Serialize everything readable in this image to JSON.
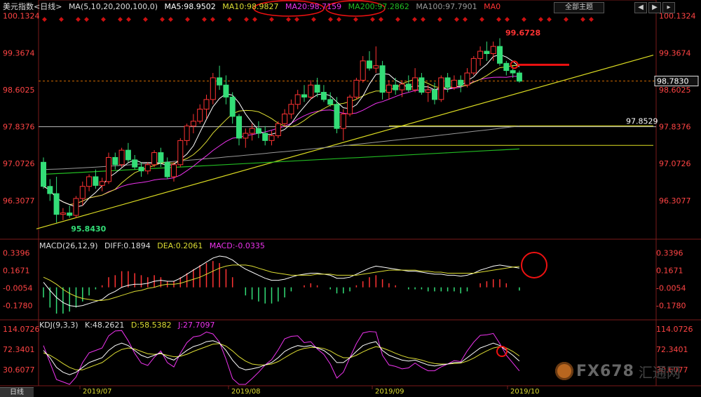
{
  "header": {
    "title": "美元指数<日线>",
    "ma_params": "MA(5,10,20,200,100,0)",
    "ma5": "MA5:98.9502",
    "ma10": "MA10:98.9827",
    "ma20": "MA20:98.7159",
    "ma200": "MA200:97.2862",
    "ma100": "MA100:97.7901",
    "ma0": "MA0"
  },
  "toolbar": {
    "dropdown_label": "全部主题",
    "nav": [
      "◀",
      "▶",
      "▸"
    ]
  },
  "macd_header": {
    "params": "MACD(26,12,9)",
    "diff": "DIFF:0.1894",
    "dea": "DEA:0.2061",
    "macd": "MACD:-0.0335"
  },
  "kdj_header": {
    "params": "KDJ(9,3,3)",
    "k": "K:48.2621",
    "d": "D:58.5382",
    "j": "J:27.7097"
  },
  "bottom_tab": "日线",
  "watermark": {
    "text": "FX678",
    "cn": "汇通网"
  },
  "colors": {
    "up": "#ff3333",
    "down": "#33dd77",
    "ma5": "#ffffff",
    "ma10": "#dddd33",
    "ma20": "#ee33ee",
    "ma200": "#22bb22",
    "ma100": "#999999",
    "trend": "#dddd22",
    "annot": "#ee1111",
    "axis": "#ff4444"
  },
  "chart_data": {
    "type": "candlestick",
    "x_labels": [
      "2019/07",
      "2019/08",
      "2019/09",
      "2019/10"
    ],
    "price_axis": {
      "ticks": [
        100.1324,
        99.3674,
        98.6025,
        97.8376,
        97.0726,
        96.3077
      ],
      "ylim": [
        95.55,
        100.2
      ]
    },
    "current_price": 98.783,
    "current_price_label": "98.7830",
    "annotations": {
      "high": 99.6728,
      "high_label": "99.6728",
      "low": 95.843,
      "low_label": "95.8430",
      "support": 97.8529,
      "support_label": "97.8529"
    },
    "ohlc": [
      [
        97.1,
        97.2,
        96.55,
        96.6
      ],
      [
        96.6,
        96.75,
        96.3,
        96.45
      ],
      [
        96.45,
        96.8,
        95.85,
        96.02
      ],
      [
        96.02,
        96.15,
        95.9,
        96.05
      ],
      [
        96.05,
        96.2,
        95.95,
        96.0
      ],
      [
        96.0,
        96.4,
        95.95,
        96.35
      ],
      [
        96.35,
        96.7,
        96.2,
        96.6
      ],
      [
        96.6,
        96.85,
        96.5,
        96.8
      ],
      [
        96.8,
        96.95,
        96.55,
        96.62
      ],
      [
        96.62,
        96.78,
        96.5,
        96.7
      ],
      [
        96.7,
        97.3,
        96.65,
        97.2
      ],
      [
        97.2,
        97.3,
        96.95,
        97.05
      ],
      [
        97.05,
        97.4,
        97.0,
        97.35
      ],
      [
        97.35,
        97.5,
        97.1,
        97.15
      ],
      [
        97.15,
        97.25,
        96.95,
        97.0
      ],
      [
        97.0,
        97.1,
        96.8,
        96.92
      ],
      [
        96.92,
        97.1,
        96.85,
        97.05
      ],
      [
        97.05,
        97.35,
        97.0,
        97.3
      ],
      [
        97.3,
        97.4,
        97.0,
        97.1
      ],
      [
        97.1,
        97.2,
        96.75,
        96.8
      ],
      [
        96.8,
        97.1,
        96.7,
        97.05
      ],
      [
        97.05,
        97.6,
        97.0,
        97.55
      ],
      [
        97.55,
        97.9,
        97.45,
        97.85
      ],
      [
        97.85,
        98.1,
        97.7,
        97.95
      ],
      [
        97.95,
        98.3,
        97.9,
        98.2
      ],
      [
        98.2,
        98.5,
        98.0,
        98.4
      ],
      [
        98.4,
        98.95,
        98.3,
        98.85
      ],
      [
        98.85,
        99.1,
        98.6,
        98.7
      ],
      [
        98.7,
        98.9,
        98.3,
        98.45
      ],
      [
        98.45,
        98.55,
        97.9,
        98.05
      ],
      [
        98.05,
        98.1,
        97.45,
        97.6
      ],
      [
        97.6,
        97.8,
        97.4,
        97.7
      ],
      [
        97.7,
        97.9,
        97.55,
        97.8
      ],
      [
        97.8,
        97.95,
        97.6,
        97.7
      ],
      [
        97.7,
        97.85,
        97.45,
        97.55
      ],
      [
        97.55,
        97.75,
        97.45,
        97.65
      ],
      [
        97.65,
        97.95,
        97.6,
        97.9
      ],
      [
        97.9,
        98.2,
        97.85,
        98.1
      ],
      [
        98.1,
        98.4,
        98.0,
        98.3
      ],
      [
        98.3,
        98.6,
        98.2,
        98.5
      ],
      [
        98.5,
        98.7,
        98.35,
        98.45
      ],
      [
        98.45,
        98.8,
        98.4,
        98.7
      ],
      [
        98.7,
        98.85,
        98.45,
        98.55
      ],
      [
        98.55,
        98.7,
        98.35,
        98.4
      ],
      [
        98.4,
        98.55,
        98.25,
        98.3
      ],
      [
        98.3,
        98.45,
        97.7,
        97.8
      ],
      [
        97.8,
        98.2,
        97.55,
        98.1
      ],
      [
        98.1,
        98.5,
        98.05,
        98.45
      ],
      [
        98.45,
        98.85,
        98.4,
        98.8
      ],
      [
        98.8,
        99.3,
        98.75,
        99.2
      ],
      [
        99.2,
        99.4,
        99.0,
        99.05
      ],
      [
        99.05,
        99.5,
        98.95,
        99.1
      ],
      [
        99.1,
        99.2,
        98.4,
        98.55
      ],
      [
        98.55,
        98.8,
        98.4,
        98.7
      ],
      [
        98.7,
        98.85,
        98.5,
        98.6
      ],
      [
        98.6,
        98.8,
        98.45,
        98.72
      ],
      [
        98.72,
        98.9,
        98.55,
        98.6
      ],
      [
        98.6,
        99.05,
        98.55,
        98.85
      ],
      [
        98.85,
        98.95,
        98.5,
        98.55
      ],
      [
        98.55,
        98.7,
        98.35,
        98.6
      ],
      [
        98.6,
        98.75,
        98.3,
        98.4
      ],
      [
        98.4,
        98.9,
        98.35,
        98.85
      ],
      [
        98.85,
        98.95,
        98.55,
        98.65
      ],
      [
        98.65,
        98.9,
        98.6,
        98.8
      ],
      [
        98.8,
        98.9,
        98.55,
        98.7
      ],
      [
        98.7,
        99.05,
        98.65,
        98.95
      ],
      [
        98.95,
        99.3,
        98.9,
        99.25
      ],
      [
        99.25,
        99.5,
        99.1,
        99.4
      ],
      [
        99.4,
        99.6,
        99.2,
        99.35
      ],
      [
        99.35,
        99.6,
        99.2,
        99.5
      ],
      [
        99.5,
        99.67,
        99.1,
        99.15
      ],
      [
        99.15,
        99.2,
        98.9,
        99.0
      ],
      [
        99.0,
        99.1,
        98.85,
        98.95
      ],
      [
        98.95,
        99.0,
        98.75,
        98.78
      ]
    ],
    "macd": {
      "ticks": [
        0.3396,
        0.1671,
        -0.0054,
        -0.178
      ],
      "ylim": [
        -0.28,
        0.4
      ],
      "diff": [
        0.05,
        -0.03,
        -0.1,
        -0.15,
        -0.18,
        -0.19,
        -0.18,
        -0.16,
        -0.14,
        -0.12,
        -0.07,
        -0.04,
        0.0,
        0.02,
        0.03,
        0.03,
        0.04,
        0.06,
        0.07,
        0.06,
        0.06,
        0.09,
        0.13,
        0.17,
        0.21,
        0.25,
        0.29,
        0.31,
        0.3,
        0.27,
        0.22,
        0.18,
        0.15,
        0.12,
        0.09,
        0.07,
        0.07,
        0.08,
        0.1,
        0.12,
        0.13,
        0.14,
        0.14,
        0.13,
        0.12,
        0.09,
        0.09,
        0.1,
        0.13,
        0.16,
        0.19,
        0.21,
        0.2,
        0.19,
        0.18,
        0.17,
        0.16,
        0.16,
        0.15,
        0.14,
        0.13,
        0.13,
        0.12,
        0.12,
        0.11,
        0.12,
        0.14,
        0.17,
        0.19,
        0.21,
        0.22,
        0.21,
        0.2,
        0.19
      ],
      "dea": [
        0.1,
        0.07,
        0.03,
        -0.02,
        -0.06,
        -0.09,
        -0.11,
        -0.12,
        -0.13,
        -0.13,
        -0.12,
        -0.1,
        -0.08,
        -0.06,
        -0.04,
        -0.03,
        -0.01,
        0.0,
        0.02,
        0.03,
        0.03,
        0.04,
        0.06,
        0.08,
        0.1,
        0.13,
        0.16,
        0.19,
        0.21,
        0.22,
        0.22,
        0.22,
        0.21,
        0.19,
        0.17,
        0.15,
        0.14,
        0.13,
        0.12,
        0.12,
        0.12,
        0.12,
        0.13,
        0.13,
        0.13,
        0.12,
        0.12,
        0.12,
        0.12,
        0.13,
        0.14,
        0.15,
        0.16,
        0.17,
        0.17,
        0.17,
        0.17,
        0.17,
        0.16,
        0.16,
        0.15,
        0.15,
        0.14,
        0.14,
        0.14,
        0.14,
        0.14,
        0.15,
        0.16,
        0.17,
        0.18,
        0.19,
        0.2,
        0.206
      ]
    },
    "kdj": {
      "ticks": [
        114.0726,
        72.3401,
        30.6077
      ],
      "ylim": [
        0,
        120
      ],
      "k": [
        70,
        55,
        35,
        25,
        20,
        25,
        35,
        45,
        50,
        55,
        70,
        80,
        85,
        80,
        70,
        60,
        55,
        60,
        65,
        55,
        50,
        60,
        70,
        78,
        82,
        88,
        90,
        85,
        70,
        50,
        35,
        30,
        32,
        35,
        40,
        45,
        55,
        68,
        75,
        80,
        78,
        80,
        75,
        70,
        60,
        45,
        45,
        55,
        68,
        80,
        85,
        88,
        70,
        60,
        55,
        50,
        48,
        50,
        45,
        40,
        38,
        40,
        42,
        45,
        45,
        55,
        65,
        75,
        80,
        85,
        80,
        70,
        60,
        48
      ],
      "d": [
        65,
        60,
        52,
        43,
        35,
        30,
        30,
        35,
        40,
        45,
        55,
        65,
        72,
        75,
        73,
        68,
        63,
        62,
        63,
        60,
        57,
        58,
        62,
        68,
        73,
        78,
        83,
        84,
        79,
        69,
        57,
        48,
        42,
        40,
        40,
        42,
        47,
        55,
        63,
        70,
        74,
        76,
        76,
        74,
        69,
        61,
        55,
        55,
        60,
        67,
        73,
        78,
        75,
        70,
        64,
        59,
        55,
        53,
        50,
        46,
        43,
        42,
        42,
        43,
        44,
        48,
        54,
        62,
        69,
        75,
        78,
        75,
        68,
        58.5
      ],
      "j": [
        80,
        45,
        10,
        5,
        0,
        15,
        45,
        65,
        70,
        75,
        100,
        110,
        111,
        90,
        64,
        44,
        39,
        56,
        69,
        45,
        36,
        64,
        86,
        98,
        100,
        108,
        104,
        87,
        52,
        12,
        0,
        0,
        12,
        25,
        40,
        51,
        71,
        94,
        99,
        100,
        86,
        88,
        73,
        62,
        42,
        13,
        25,
        55,
        84,
        106,
        109,
        108,
        60,
        40,
        37,
        32,
        34,
        44,
        35,
        28,
        28,
        36,
        42,
        49,
        47,
        69,
        87,
        101,
        102,
        105,
        84,
        60,
        44,
        27.7
      ]
    }
  }
}
